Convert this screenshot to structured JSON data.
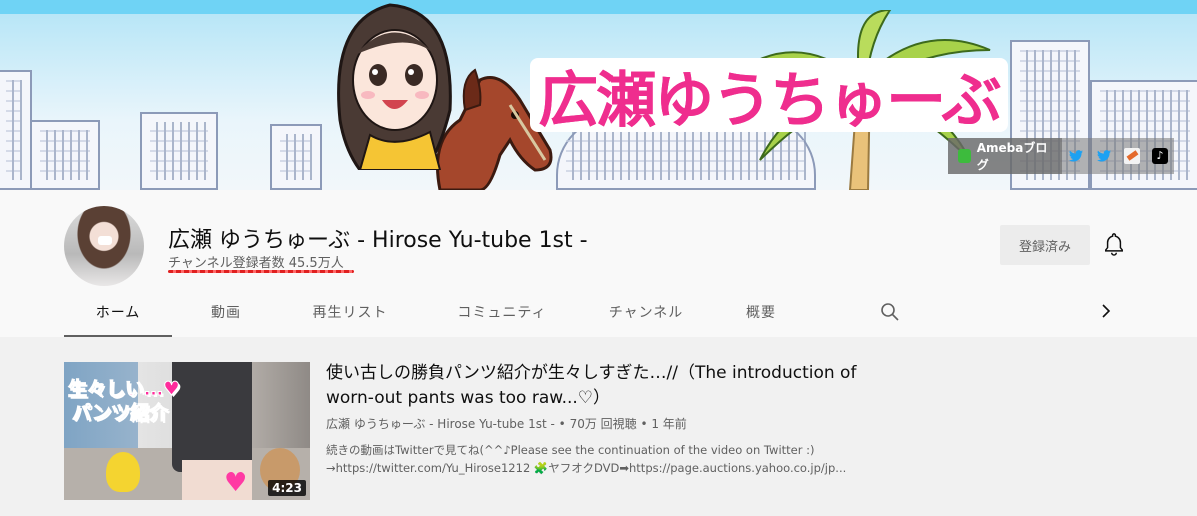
{
  "banner": {
    "title": "広瀬ゆうちゅーぶ",
    "links": [
      {
        "label": "Amebaブログ",
        "icon": "ameba-icon"
      },
      {
        "label": "",
        "icon": "twitter-icon"
      },
      {
        "label": "",
        "icon": "twitter-icon"
      },
      {
        "label": "",
        "icon": "yahoo-auction-icon"
      },
      {
        "label": "",
        "icon": "tiktok-icon"
      }
    ]
  },
  "channel": {
    "name": "広瀬 ゆうちゅーぶ - Hirose Yu-tube 1st -",
    "subscribers": "チャンネル登録者数 45.5万人",
    "subscribe_label": "登録済み",
    "avatar_icon": "channel-avatar"
  },
  "tabs": [
    {
      "label": "ホーム",
      "active": true
    },
    {
      "label": "動画",
      "active": false
    },
    {
      "label": "再生リスト",
      "active": false
    },
    {
      "label": "コミュニティ",
      "active": false
    },
    {
      "label": "チャンネル",
      "active": false
    },
    {
      "label": "概要",
      "active": false
    }
  ],
  "featured_video": {
    "thumbnail_text_1": "生々しい…♥",
    "thumbnail_text_2": "パンツ紹介",
    "duration": "4:23",
    "title": "使い古しの勝負パンツ紹介が生々しすぎた…//（The introduction of worn-out pants was too raw...♡）",
    "meta": "広瀬 ゆうちゅーぶ - Hirose Yu-tube 1st - • 70万 回視聴 • 1 年前",
    "description_line1": "続きの動画はTwitterで見てね(^^♪Please see the continuation of the video on Twitter :)",
    "description_line2": "→https://twitter.com/Yu_Hirose1212 🧩ヤフオクDVD➡https://page.auctions.yahoo.co.jp/jp..."
  },
  "colors": {
    "accent_pink": "#ef2d8e",
    "twitter_blue": "#1da1f2",
    "sky": "#6fd3f5"
  }
}
